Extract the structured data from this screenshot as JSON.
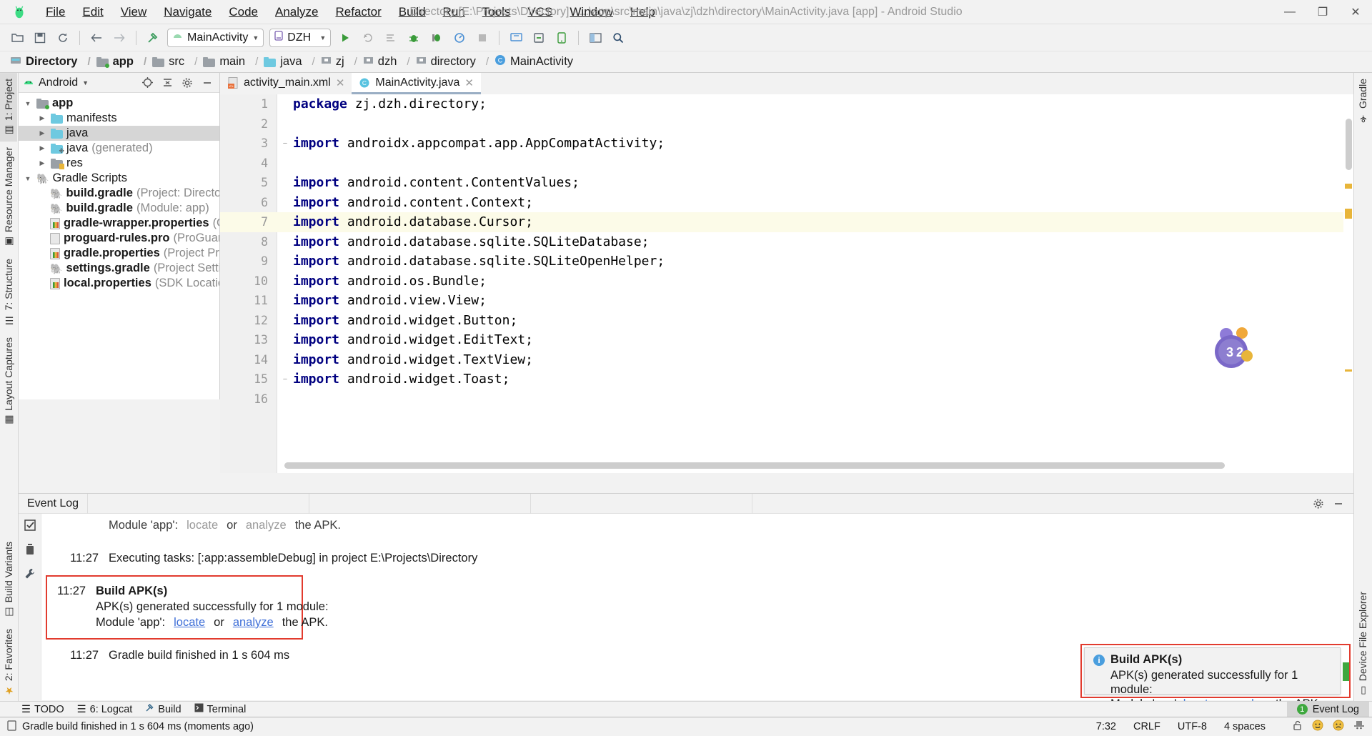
{
  "window": {
    "title": "Directory [E:\\Projects\\Directory] - ...\\app\\src\\main\\java\\zj\\dzh\\directory\\MainActivity.java [app] - Android Studio",
    "minimize": "—",
    "maximize": "❐",
    "close": "✕"
  },
  "menu": [
    {
      "label": "File"
    },
    {
      "label": "Edit"
    },
    {
      "label": "View"
    },
    {
      "label": "Navigate"
    },
    {
      "label": "Code"
    },
    {
      "label": "Analyze"
    },
    {
      "label": "Refactor"
    },
    {
      "label": "Build"
    },
    {
      "label": "Run"
    },
    {
      "label": "Tools"
    },
    {
      "label": "VCS"
    },
    {
      "label": "Window"
    },
    {
      "label": "Help"
    }
  ],
  "toolbar": {
    "run_config": "MainActivity",
    "device": "DZH",
    "icons": [
      "open-folder-icon",
      "save-all-icon",
      "sync-project-icon",
      "back-icon",
      "forward-icon",
      "build-hammer-icon",
      "run-icon",
      "rerun-icon",
      "apply-changes-icon",
      "debug-icon",
      "attach-debugger-icon",
      "profiler-icon",
      "stop-icon",
      "avd-manager-icon",
      "sdk-manager-icon",
      "device-file-explorer-icon",
      "layout-inspector-icon",
      "search-icon"
    ]
  },
  "breadcrumb": [
    {
      "label": "Directory",
      "icon": "module-icon",
      "bold": true
    },
    {
      "label": "app",
      "icon": "folder-module-icon",
      "bold": true
    },
    {
      "label": "src",
      "icon": "folder-gray-icon",
      "bold": false
    },
    {
      "label": "main",
      "icon": "folder-gray-icon",
      "bold": false
    },
    {
      "label": "java",
      "icon": "folder-blue-icon",
      "bold": false
    },
    {
      "label": "zj",
      "icon": "package-icon",
      "bold": false
    },
    {
      "label": "dzh",
      "icon": "package-icon",
      "bold": false
    },
    {
      "label": "directory",
      "icon": "package-icon",
      "bold": false
    },
    {
      "label": "MainActivity",
      "icon": "class-icon",
      "bold": false
    }
  ],
  "left_strip": [
    {
      "label": "1: Project",
      "selected": true,
      "icon": "project-icon"
    },
    {
      "label": "Resource Manager",
      "selected": false,
      "icon": "resource-icon"
    },
    {
      "label": "7: Structure",
      "selected": false,
      "icon": "structure-icon"
    },
    {
      "label": "Layout Captures",
      "selected": false,
      "icon": "layout-icon"
    },
    {
      "label": "Build Variants",
      "selected": false,
      "icon": "variants-icon"
    },
    {
      "label": "2: Favorites",
      "selected": false,
      "icon": "star-icon"
    }
  ],
  "right_strip": [
    {
      "label": "Gradle",
      "icon": "gradle-icon"
    },
    {
      "label": "Device File Explorer",
      "icon": "device-icon"
    }
  ],
  "project_panel": {
    "title": "Android",
    "head_icons": [
      "locate-icon",
      "collapse-all-icon",
      "settings-gear-icon",
      "hide-icon"
    ],
    "tree": [
      {
        "indent": 1,
        "arrow": "▼",
        "icon": "folder-module",
        "name": "app",
        "sub": "",
        "selected": false,
        "bold": true
      },
      {
        "indent": 2,
        "arrow": "▶",
        "icon": "folder-blue",
        "name": "manifests",
        "sub": "",
        "selected": false,
        "bold": false
      },
      {
        "indent": 2,
        "arrow": "▶",
        "icon": "folder-blue",
        "name": "java",
        "sub": "",
        "selected": true,
        "bold": false
      },
      {
        "indent": 2,
        "arrow": "▶",
        "icon": "folder-gen",
        "name": "java",
        "sub": "(generated)",
        "selected": false,
        "bold": false
      },
      {
        "indent": 2,
        "arrow": "▶",
        "icon": "folder-res",
        "name": "res",
        "sub": "",
        "selected": false,
        "bold": false
      },
      {
        "indent": 1,
        "arrow": "▼",
        "icon": "gradle-elephant",
        "name": "Gradle Scripts",
        "sub": "",
        "selected": false,
        "bold": false
      },
      {
        "indent": 3,
        "arrow": "",
        "icon": "gradle-elephant",
        "name": "build.gradle",
        "sub": "(Project: Directory)",
        "selected": false,
        "bold": true
      },
      {
        "indent": 3,
        "arrow": "",
        "icon": "gradle-elephant",
        "name": "build.gradle",
        "sub": "(Module: app)",
        "selected": false,
        "bold": true
      },
      {
        "indent": 3,
        "arrow": "",
        "icon": "properties",
        "name": "gradle-wrapper.properties",
        "sub": "(Gradle Ve",
        "selected": false,
        "bold": true
      },
      {
        "indent": 3,
        "arrow": "",
        "icon": "textfile",
        "name": "proguard-rules.pro",
        "sub": "(ProGuard Rules fo",
        "selected": false,
        "bold": true
      },
      {
        "indent": 3,
        "arrow": "",
        "icon": "properties",
        "name": "gradle.properties",
        "sub": "(Project Properties)",
        "selected": false,
        "bold": true
      },
      {
        "indent": 3,
        "arrow": "",
        "icon": "gradle-elephant",
        "name": "settings.gradle",
        "sub": "(Project Settings)",
        "selected": false,
        "bold": true
      },
      {
        "indent": 3,
        "arrow": "",
        "icon": "properties",
        "name": "local.properties",
        "sub": "(SDK Location)",
        "selected": false,
        "bold": true
      }
    ]
  },
  "editor": {
    "tabs": [
      {
        "label": "activity_main.xml",
        "icon": "xml-file-icon",
        "active": false
      },
      {
        "label": "MainActivity.java",
        "icon": "java-class-icon",
        "active": true
      }
    ],
    "highlighted_line": 7,
    "lines": [
      {
        "n": 1,
        "fold": "",
        "kw": "package",
        "rest": " zj.dzh.directory;"
      },
      {
        "n": 2,
        "fold": "",
        "kw": "",
        "rest": ""
      },
      {
        "n": 3,
        "fold": "−",
        "kw": "import",
        "rest": " androidx.appcompat.app.AppCompatActivity;"
      },
      {
        "n": 4,
        "fold": "",
        "kw": "",
        "rest": ""
      },
      {
        "n": 5,
        "fold": "",
        "kw": "import",
        "rest": " android.content.ContentValues;"
      },
      {
        "n": 6,
        "fold": "",
        "kw": "import",
        "rest": " android.content.Context;"
      },
      {
        "n": 7,
        "fold": "",
        "kw": "import",
        "rest": " android.database.Cursor;"
      },
      {
        "n": 8,
        "fold": "",
        "kw": "import",
        "rest": " android.database.sqlite.SQLiteDatabase;"
      },
      {
        "n": 9,
        "fold": "",
        "kw": "import",
        "rest": " android.database.sqlite.SQLiteOpenHelper;"
      },
      {
        "n": 10,
        "fold": "",
        "kw": "import",
        "rest": " android.os.Bundle;"
      },
      {
        "n": 11,
        "fold": "",
        "kw": "import",
        "rest": " android.view.View;"
      },
      {
        "n": 12,
        "fold": "",
        "kw": "import",
        "rest": " android.widget.Button;"
      },
      {
        "n": 13,
        "fold": "",
        "kw": "import",
        "rest": " android.widget.EditText;"
      },
      {
        "n": 14,
        "fold": "",
        "kw": "import",
        "rest": " android.widget.TextView;"
      },
      {
        "n": 15,
        "fold": "−",
        "kw": "import",
        "rest": " android.widget.Toast;"
      },
      {
        "n": 16,
        "fold": "",
        "kw": "",
        "rest": ""
      }
    ],
    "watermark": "32"
  },
  "event_log": {
    "tab_label": "Event Log",
    "head_icons": [
      "settings-gear-icon",
      "hide-icon"
    ],
    "side_icons": [
      "mark-read-icon",
      "delete-icon",
      "settings-wrench-icon"
    ],
    "entries": [
      {
        "type": "plain_indent",
        "time": "",
        "text_parts": [
          {
            "t": "Module 'app': ",
            "style": "normal"
          },
          {
            "t": "locate",
            "style": "link-gray"
          },
          {
            "t": " or ",
            "style": "normal"
          },
          {
            "t": "analyze",
            "style": "link-gray"
          },
          {
            "t": " the APK.",
            "style": "normal"
          }
        ]
      },
      {
        "type": "plain",
        "time": "11:27",
        "text": "Executing tasks: [:app:assembleDebug] in project E:\\Projects\\Directory"
      },
      {
        "type": "boxed",
        "time": "11:27",
        "title": "Build APK(s)",
        "line2": "APK(s) generated successfully for 1 module:",
        "line3_parts": [
          {
            "t": "Module 'app': ",
            "style": "normal"
          },
          {
            "t": "locate",
            "style": "link"
          },
          {
            "t": " or ",
            "style": "normal"
          },
          {
            "t": "analyze",
            "style": "link"
          },
          {
            "t": " the APK.",
            "style": "normal"
          }
        ]
      },
      {
        "type": "plain",
        "time": "11:27",
        "text": "Gradle build finished in 1 s 604 ms"
      }
    ]
  },
  "notification": {
    "title": "Build APK(s)",
    "line1": "APK(s) generated successfully for 1 module:",
    "line2_prefix": "Module 'app': ",
    "link1": "locate",
    "line2_mid": " or ",
    "link2": "analyze",
    "line2_suffix": " the APK."
  },
  "bottom_bar": {
    "items": [
      {
        "label": "TODO",
        "icon": "todo-icon",
        "underline_index": -1
      },
      {
        "label": "6: Logcat",
        "icon": "logcat-icon",
        "underline_index": 0
      },
      {
        "label": "Build",
        "icon": "build-hammer-icon",
        "underline_index": -1
      },
      {
        "label": "Terminal",
        "icon": "terminal-icon",
        "underline_index": -1
      }
    ],
    "event_log_btn": "Event Log",
    "event_log_count": "1"
  },
  "status_bar": {
    "message": "Gradle build finished in 1 s 604 ms (moments ago)",
    "caret_position": "7:32",
    "line_separator": "CRLF",
    "encoding": "UTF-8",
    "indent": "4 spaces",
    "icons": [
      "lock-open-icon",
      "happy-face-icon",
      "sad-face-icon",
      "inspector-hat-icon"
    ]
  },
  "colors": {
    "accent_blue": "#4a9ede",
    "keyword": "#000080",
    "red_box": "#e23b2e",
    "green": "#3ea83e",
    "link": "#3f6fd8"
  }
}
